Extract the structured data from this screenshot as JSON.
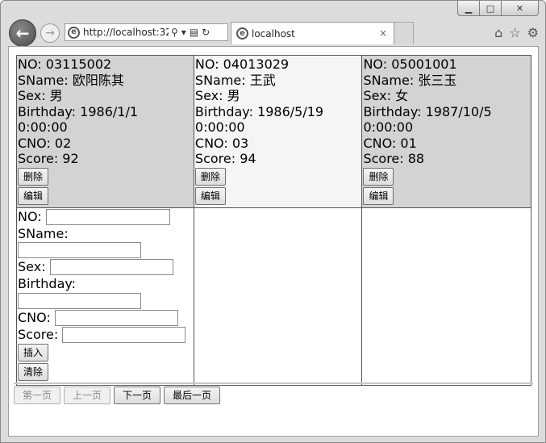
{
  "browser": {
    "address": "http://localhost:32",
    "tab_title": "localhost",
    "tab_close": "×",
    "window_controls": {
      "minimize": "▁",
      "maximize": "□",
      "close": "✕"
    },
    "icons": [
      "back-arrow-icon",
      "forward-arrow-icon",
      "ie-icon",
      "search-icon",
      "refresh-icon",
      "home-icon",
      "star-icon",
      "gear-icon"
    ]
  },
  "records": [
    {
      "no": "NO: 03115002",
      "sname": "SName: 欧阳陈其",
      "sex": "Sex: 男",
      "birthday": "Birthday: 1986/1/1",
      "birthday_time": "0:00:00",
      "cno": "CNO: 02",
      "score": "Score: 92",
      "delete_label": "删除",
      "edit_label": "编辑"
    },
    {
      "no": "NO: 04013029",
      "sname": "SName: 王武",
      "sex": "Sex: 男",
      "birthday": "Birthday: 1986/5/19",
      "birthday_time": "0:00:00",
      "cno": "CNO: 03",
      "score": "Score: 94",
      "delete_label": "删除",
      "edit_label": "编辑"
    },
    {
      "no": "NO: 05001001",
      "sname": "SName: 张三玉",
      "sex": "Sex: 女",
      "birthday": "Birthday: 1987/10/5",
      "birthday_time": "0:00:00",
      "cno": "CNO: 01",
      "score": "Score: 88",
      "delete_label": "删除",
      "edit_label": "编辑"
    }
  ],
  "insert_form": {
    "no_label": "NO:",
    "sname_label": "SName:",
    "sex_label": "Sex:",
    "birthday_label": "Birthday:",
    "cno_label": "CNO:",
    "score_label": "Score:",
    "insert_label": "插入",
    "clear_label": "清除"
  },
  "pager": {
    "first": "第一页",
    "prev": "上一页",
    "next": "下一页",
    "last": "最后一页"
  }
}
